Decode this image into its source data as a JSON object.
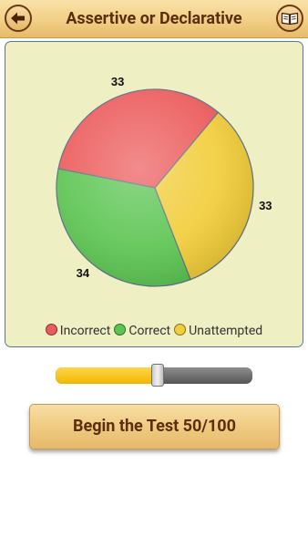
{
  "header": {
    "title": "Assertive or Declarative",
    "back_icon": "arrow-left-icon",
    "book_icon": "book-icon"
  },
  "chart_data": {
    "type": "pie",
    "title": "",
    "slices": [
      {
        "label": "Incorrect",
        "value": 33,
        "color": "#ec5b5b"
      },
      {
        "label": "Correct",
        "value": 34,
        "color": "#5cc552"
      },
      {
        "label": "Unattempted",
        "value": 33,
        "color": "#f2cd3a"
      }
    ],
    "legend_placement": "bottom-center",
    "data_labels": true
  },
  "slider": {
    "value": 50,
    "max": 100,
    "fill_color": "#f5c21b"
  },
  "start_button": {
    "label": "Begin the Test 50/100"
  }
}
